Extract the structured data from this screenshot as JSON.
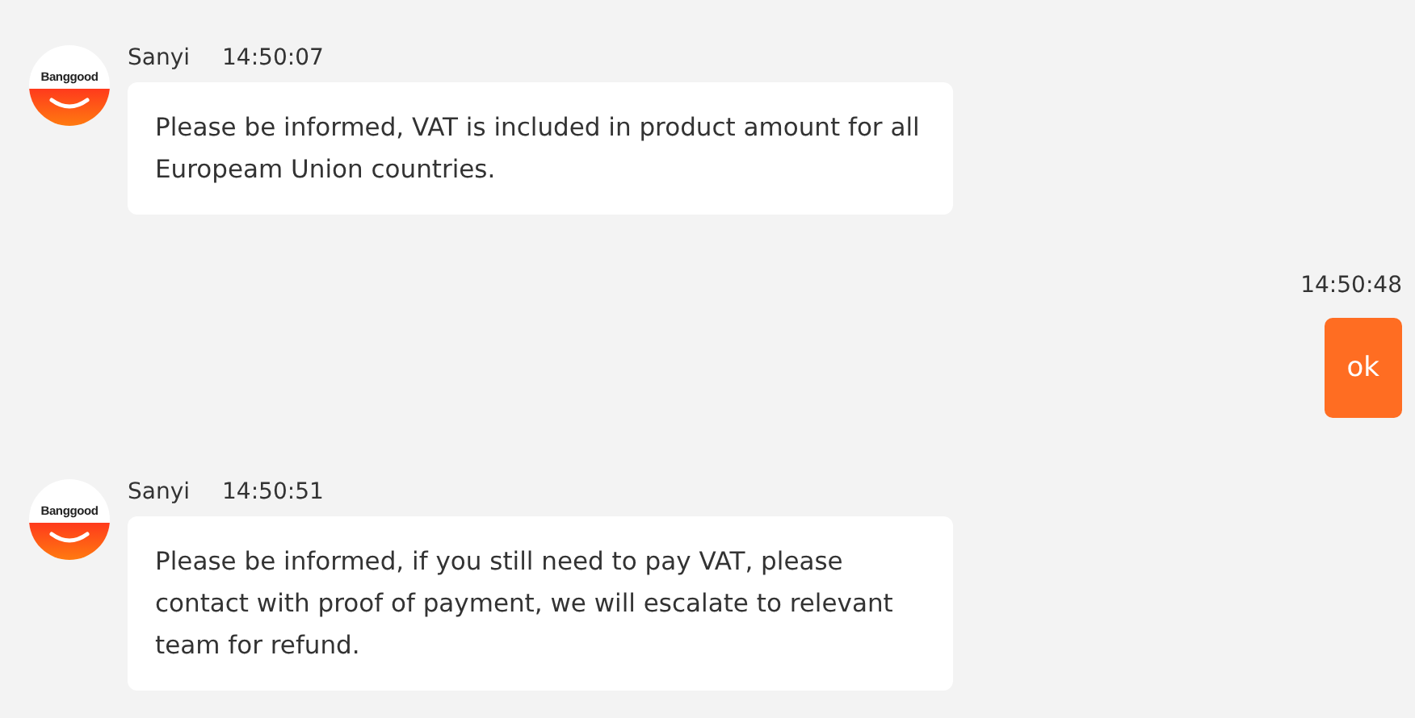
{
  "messages": [
    {
      "kind": "incoming",
      "sender": "Sanyi",
      "time": "14:50:07",
      "avatar_text": "Banggood",
      "text": "Please be informed, VAT is included in product amount for all Europeam Union countries."
    },
    {
      "kind": "outgoing",
      "time": "14:50:48",
      "text": "ok"
    },
    {
      "kind": "incoming",
      "sender": "Sanyi",
      "time": "14:50:51",
      "avatar_text": "Banggood",
      "text": "Please be informed, if you still need to pay VAT, please contact with proof of payment, we will escalate to relevant team for refund."
    }
  ]
}
